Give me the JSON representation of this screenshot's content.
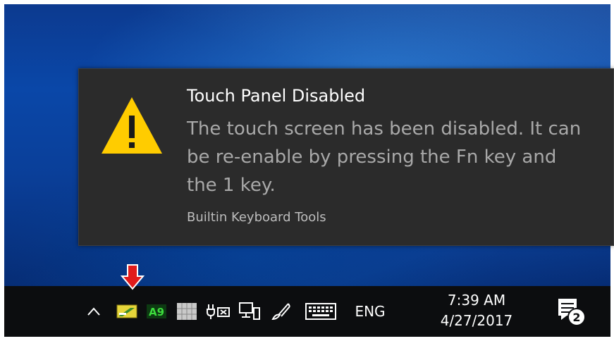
{
  "notification": {
    "title": "Touch Panel Disabled",
    "message": "The touch screen has been disabled. It can be re-enable by pressing the Fn key and the 1 key.",
    "source": "Builtin Keyboard Tools",
    "icon": "warning-icon"
  },
  "taskbar": {
    "tray_icons": [
      "chevron-up-icon",
      "keyboard-tool-icon",
      "a-badge-icon",
      "grid-icon",
      "power-icon",
      "network-icon",
      "pen-icon",
      "touch-keyboard-icon"
    ],
    "language": "ENG",
    "time": "7:39 AM",
    "date": "4/27/2017",
    "action_center_count": "2"
  },
  "colors": {
    "accent_warning": "#ffcc00",
    "annotation_arrow": "#e11b1b",
    "toast_background": "#2b2b2b",
    "taskbar_background": "#0c0d0f"
  }
}
